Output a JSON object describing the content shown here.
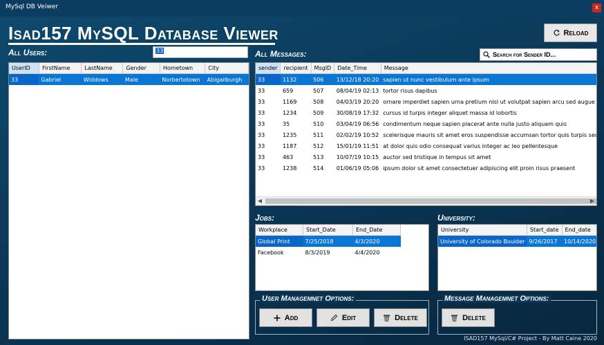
{
  "window": {
    "title": "MySql DB Veiwer",
    "close_label": "x"
  },
  "app_title": "Isad157 MySQL Database Viewer",
  "reload_label": "Reload",
  "users": {
    "label": "All Users:",
    "search_value": "33",
    "columns": [
      "UserID",
      "FirstName",
      "LastName",
      "Gender",
      "Hometown",
      "City"
    ],
    "rows": [
      [
        "33",
        "Gabriel",
        "Widdows",
        "Male",
        "Norbertotown",
        "Abigailburgh"
      ]
    ]
  },
  "messages": {
    "label": "All Messages:",
    "search_label": "Search for Sender ID...",
    "columns": [
      "sender",
      "recipient",
      "MsgID",
      "Date_Time",
      "Message"
    ],
    "rows": [
      [
        "33",
        "1132",
        "506",
        "13/12/18 20:20",
        "sapien ut nunc vestibulum ante ipsum"
      ],
      [
        "33",
        "659",
        "507",
        "08/04/19 02:13",
        "tortor risus dapibus"
      ],
      [
        "33",
        "1169",
        "508",
        "04/03/19 20:20",
        "ornare imperdiet sapien urna pretium nisl ut volutpat sapien arcu sed augue"
      ],
      [
        "33",
        "1234",
        "509",
        "30/08/19 17:32",
        "cursus id turpis integer aliquet massa id lobortis"
      ],
      [
        "33",
        "35",
        "510",
        "03/04/19 06:56",
        "condimentum neque sapien placerat ante nulla justo aliquam quis"
      ],
      [
        "33",
        "1235",
        "511",
        "02/02/19 10:52",
        "scelerisque mauris sit amet eros suspendisse accumsan tortor quis turpis sed ante"
      ],
      [
        "33",
        "1187",
        "512",
        "15/01/19 11:51",
        "at dolor quis odio consequat varius integer ac leo pellentesque"
      ],
      [
        "33",
        "463",
        "513",
        "10/07/19 10:15",
        "auctor sed tristique in tempus sit amet"
      ],
      [
        "33",
        "1238",
        "514",
        "01/06/19 05:06",
        "ipsum dolor sit amet consectetuer adipiscing elit proin risus praesent"
      ]
    ]
  },
  "jobs": {
    "label": "Jobs:",
    "columns": [
      "Workplace",
      "Start_Date",
      "End_Date"
    ],
    "rows": [
      [
        "Global Print",
        "7/25/2018",
        "4/3/2020"
      ],
      [
        "Facebook",
        "8/3/2019",
        "4/4/2020"
      ]
    ]
  },
  "university": {
    "label": "University:",
    "columns": [
      "University",
      "Start_date",
      "End_date"
    ],
    "rows": [
      [
        "University of Colorado Boulder",
        "9/26/2017",
        "10/14/2020"
      ]
    ]
  },
  "user_options": {
    "label": "User Managemnet Options:",
    "add_label": "Add",
    "edit_label": "Edit",
    "delete_label": "Delete"
  },
  "message_options": {
    "label": "Message Managemnet Options:",
    "delete_label": "Delete"
  },
  "footer": "ISAD157 MySql/C# Project - By Matt Caine 2020",
  "colors": {
    "selection": "#0a77d6",
    "background": "#0a3554"
  },
  "icons": {
    "reload": "refresh-icon",
    "search": "search-icon",
    "add": "plus-icon",
    "edit": "pencil-icon",
    "delete": "trash-icon"
  }
}
